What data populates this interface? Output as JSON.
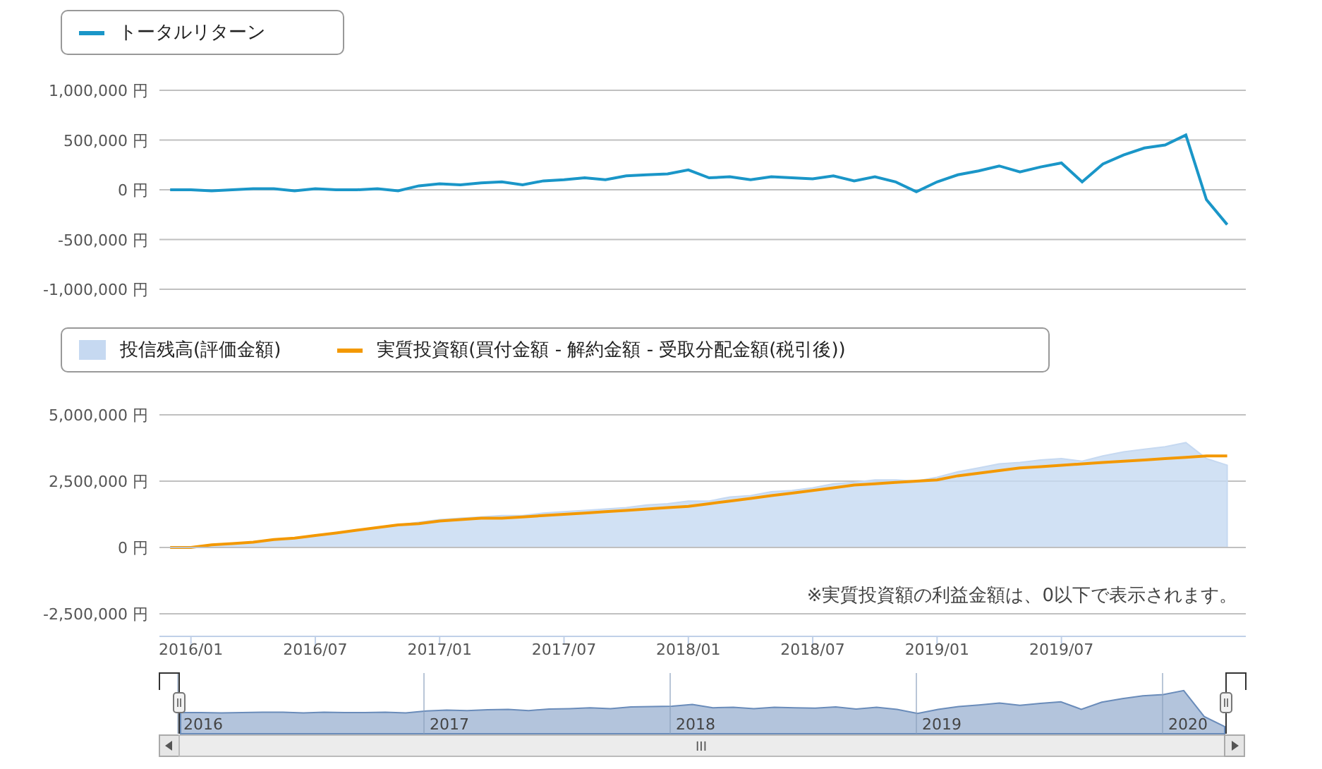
{
  "return_chart": {
    "chart_data": {
      "type": "line",
      "grid": true,
      "series": [
        {
          "name": "トータルリターン",
          "color": "#1a96c8",
          "values": [
            0,
            0,
            -10000,
            0,
            10000,
            10000,
            -10000,
            10000,
            0,
            0,
            10000,
            -10000,
            40000,
            60000,
            50000,
            70000,
            80000,
            50000,
            90000,
            100000,
            120000,
            100000,
            140000,
            150000,
            160000,
            200000,
            120000,
            130000,
            100000,
            130000,
            120000,
            110000,
            140000,
            90000,
            130000,
            80000,
            -20000,
            80000,
            150000,
            190000,
            240000,
            180000,
            230000,
            270000,
            80000,
            260000,
            350000,
            420000,
            450000,
            550000,
            -100000,
            -350000
          ]
        }
      ],
      "ylim": [
        -1000000,
        1000000
      ],
      "yticks": [
        {
          "value": 1000000,
          "label": "1,000,000 円"
        },
        {
          "value": 500000,
          "label": "500,000 円"
        },
        {
          "value": 0,
          "label": "0 円"
        },
        {
          "value": -500000,
          "label": "-500,000 円"
        },
        {
          "value": -1000000,
          "label": "-1,000,000 円"
        }
      ]
    }
  },
  "balance_chart": {
    "chart_data": {
      "type": "area",
      "grid": true,
      "categories": [
        null,
        "2016/01",
        null,
        null,
        null,
        null,
        null,
        "2016/07",
        null,
        null,
        null,
        null,
        null,
        "2017/01",
        null,
        null,
        null,
        null,
        null,
        "2017/07",
        null,
        null,
        null,
        null,
        null,
        "2018/01",
        null,
        null,
        null,
        null,
        null,
        "2018/07",
        null,
        null,
        null,
        null,
        null,
        "2019/01",
        null,
        null,
        null,
        null,
        null,
        "2019/07",
        null,
        null,
        null,
        null,
        null,
        null,
        null,
        null
      ],
      "series": [
        {
          "name": "投信残高(評価金額)",
          "type": "area",
          "color": "#c6d9f1",
          "values": [
            0,
            0,
            100000,
            150000,
            200000,
            300000,
            350000,
            450000,
            550000,
            650000,
            750000,
            850000,
            950000,
            1050000,
            1100000,
            1150000,
            1200000,
            1200000,
            1300000,
            1350000,
            1400000,
            1450000,
            1500000,
            1600000,
            1650000,
            1750000,
            1750000,
            1900000,
            1950000,
            2100000,
            2150000,
            2250000,
            2400000,
            2450000,
            2550000,
            2550000,
            2500000,
            2650000,
            2850000,
            3000000,
            3150000,
            3200000,
            3300000,
            3350000,
            3250000,
            3450000,
            3600000,
            3700000,
            3800000,
            3950000,
            3350000,
            3100000
          ]
        },
        {
          "name": "実質投資額(買付金額 - 解約金額 - 受取分配金額(税引後))",
          "type": "line",
          "color": "#f39800",
          "values": [
            0,
            0,
            100000,
            150000,
            200000,
            300000,
            350000,
            450000,
            550000,
            650000,
            750000,
            850000,
            900000,
            1000000,
            1050000,
            1100000,
            1100000,
            1150000,
            1200000,
            1250000,
            1300000,
            1350000,
            1400000,
            1450000,
            1500000,
            1550000,
            1650000,
            1750000,
            1850000,
            1950000,
            2050000,
            2150000,
            2250000,
            2350000,
            2400000,
            2450000,
            2500000,
            2550000,
            2700000,
            2800000,
            2900000,
            3000000,
            3050000,
            3100000,
            3150000,
            3200000,
            3250000,
            3300000,
            3350000,
            3400000,
            3450000,
            3450000
          ]
        }
      ],
      "ylim": [
        -2500000,
        5000000
      ],
      "yticks": [
        {
          "value": 5000000,
          "label": "5,000,000 円"
        },
        {
          "value": 2500000,
          "label": "2,500,000 円"
        },
        {
          "value": 0,
          "label": "0 円"
        },
        {
          "value": -2500000,
          "label": "-2,500,000 円"
        }
      ]
    },
    "note": "※実質投資額の利益金額は、0以下で表示されます。"
  },
  "navigator": {
    "year_labels": [
      "2016",
      "2017",
      "2018",
      "2019",
      "2020"
    ],
    "scrollbar_grip": "III"
  }
}
